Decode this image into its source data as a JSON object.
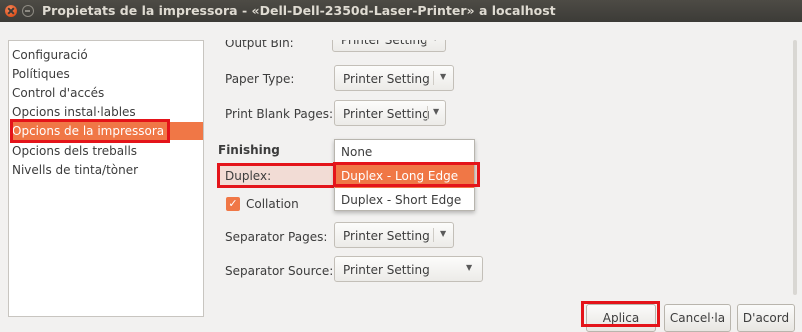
{
  "window": {
    "title": "Propietats de la impressora - «Dell-Dell-2350d-Laser-Printer» a localhost"
  },
  "sidebar": {
    "items": [
      {
        "label": "Configuració"
      },
      {
        "label": "Polítiques"
      },
      {
        "label": "Control d'accés"
      },
      {
        "label": "Opcions instal·lables"
      },
      {
        "label": "Opcions de la impressora",
        "selected": true
      },
      {
        "label": "Opcions dels treballs"
      },
      {
        "label": "Nivells de tinta/tòner"
      }
    ]
  },
  "options": {
    "output_bin": {
      "label": "Output Bin:",
      "value": "Printer Setting"
    },
    "paper_type": {
      "label": "Paper Type:",
      "value": "Printer Setting"
    },
    "print_blank_pages": {
      "label": "Print Blank Pages:",
      "value": "Printer Setting"
    },
    "finishing_title": "Finishing",
    "duplex": {
      "label": "Duplex:"
    },
    "collation": {
      "label": "Collation",
      "checked": true
    },
    "separator_pages": {
      "label": "Separator Pages:",
      "value": "Printer Setting"
    },
    "separator_source": {
      "label": "Separator Source:",
      "value": "Printer Setting"
    }
  },
  "duplex_menu": {
    "items": [
      {
        "label": "None"
      },
      {
        "label": "Duplex - Long Edge",
        "active": true
      },
      {
        "label": "Duplex - Short Edge"
      }
    ]
  },
  "buttons": {
    "apply": "Aplica",
    "cancel": "Cancel·la",
    "ok": "D'acord"
  },
  "colors": {
    "accent": "#f07746",
    "highlight_box": "#e4141a",
    "titlebar": "#3c3b37"
  }
}
